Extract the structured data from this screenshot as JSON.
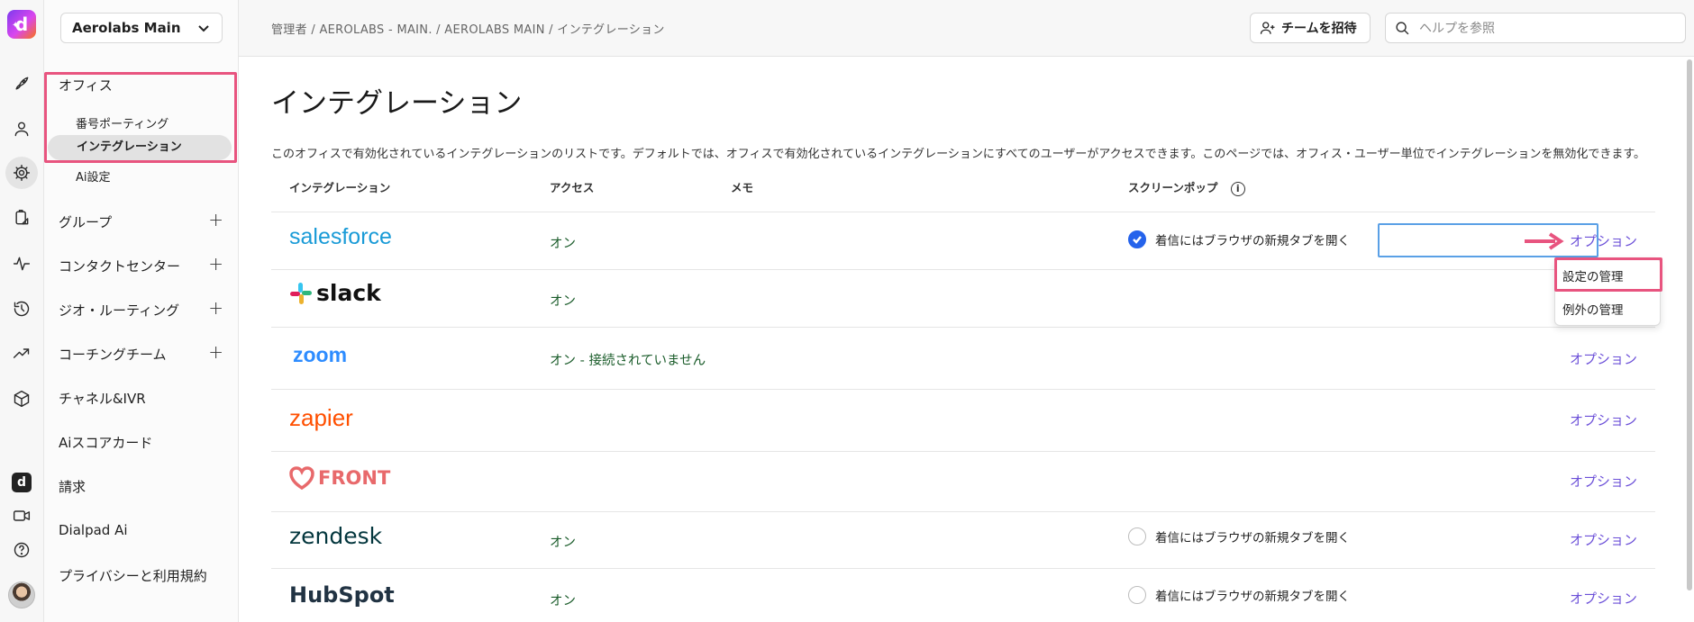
{
  "rail": {
    "logo_letter": "d",
    "dp_label": "d",
    "icons": [
      "rocket-icon",
      "user-icon",
      "gear-icon",
      "clipboard-icon",
      "activity-icon",
      "history-icon",
      "trending-icon",
      "cube-icon",
      "video-icon",
      "help-icon"
    ]
  },
  "sidebar": {
    "workspace": "Aerolabs Main",
    "office": "オフィス",
    "sub_items": [
      "番号ポーティング",
      "インテグレーション",
      "Ai設定"
    ],
    "items": [
      "グループ",
      "コンタクトセンター",
      "ジオ・ルーティング",
      "コーチングチーム",
      "チャネル&IVR",
      "Aiスコアカード",
      "請求",
      "Dialpad Ai",
      "プライバシーと利用規約"
    ]
  },
  "topbar": {
    "breadcrumb": "管理者 / AEROLABS - MAIN. / AEROLABS MAIN / インテグレーション",
    "invite": "チームを招待",
    "search_placeholder": "ヘルプを参照"
  },
  "main": {
    "title": "インテグレーション",
    "description": "このオフィスで有効化されているインテグレーションのリストです。デフォルトでは、オフィスで有効化されているインテグレーションにすべてのユーザーがアクセスできます。このページでは、オフィス・ユーザー単位でインテグレーションを無効化できます。",
    "headers": {
      "integration": "インテグレーション",
      "access": "アクセス",
      "memo": "メモ",
      "screenpop": "スクリーンポップ",
      "info": "i"
    },
    "rows": [
      {
        "name": "salesforce",
        "access": "オン",
        "screenpop": "着信にはブラウザの新規タブを開く",
        "screenpop_checked": true,
        "option": "オプション"
      },
      {
        "name": "slack",
        "access": "オン",
        "screenpop": "",
        "screenpop_checked": false,
        "option": ""
      },
      {
        "name": "zoom",
        "access": "オン - 接続されていません",
        "screenpop": "",
        "screenpop_checked": false,
        "option": "オプション"
      },
      {
        "name": "zapier",
        "access": "",
        "screenpop": "",
        "screenpop_checked": false,
        "option": "オプション"
      },
      {
        "name": "FRONT",
        "access": "",
        "screenpop": "",
        "screenpop_checked": false,
        "option": "オプション"
      },
      {
        "name": "zendesk",
        "access": "オン",
        "screenpop": "着信にはブラウザの新規タブを開く",
        "screenpop_checked": false,
        "option": "オプション"
      },
      {
        "name": "HubSpot",
        "access": "オン",
        "screenpop": "着信にはブラウザの新規タブを開く",
        "screenpop_checked": false,
        "option": "オプション"
      }
    ],
    "dropdown": [
      "設定の管理",
      "例外の管理"
    ]
  },
  "colors": {
    "accent": "#6b4fd8",
    "highlight": "#e8547f",
    "access_text": "#1a5c2a",
    "check": "#2563eb"
  }
}
